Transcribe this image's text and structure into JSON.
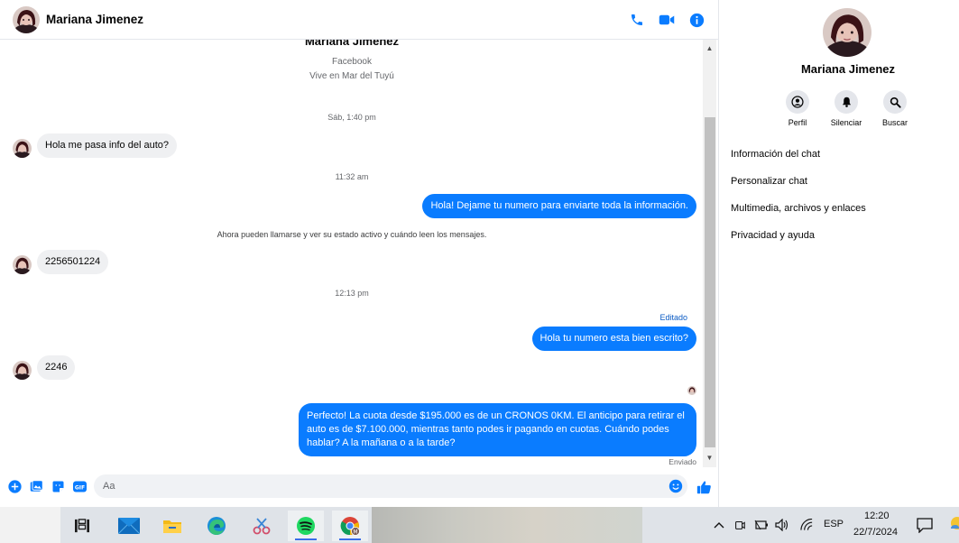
{
  "contact": {
    "name": "Mariana Jimenez"
  },
  "intro": {
    "name": "Mariana Jimenez",
    "platform": "Facebook",
    "location": "Vive en Mar del Tuyú"
  },
  "messages": [
    {
      "type": "timestamp",
      "text": "Sáb, 1:40 pm"
    },
    {
      "type": "in",
      "text": "Hola me pasa info del auto?"
    },
    {
      "type": "timestamp",
      "text": "11:32 am"
    },
    {
      "type": "out",
      "text": "Hola! Dejame tu numero  para enviarte toda la información."
    },
    {
      "type": "system",
      "text": "Ahora pueden llamarse y ver su estado activo y cuándo leen los mensajes."
    },
    {
      "type": "in",
      "text": "2256501224"
    },
    {
      "type": "timestamp",
      "text": "12:13 pm"
    },
    {
      "type": "label",
      "text": "Editado"
    },
    {
      "type": "out",
      "text": "Hola tu numero esta bien escrito?"
    },
    {
      "type": "in",
      "text": "2246"
    },
    {
      "type": "out",
      "text": "Perfecto! La cuota desde $195.000 es de un CRONOS 0KM. El anticipo para retirar el auto es de $7.100.000, mientras tanto podes ir pagando en cuotas. Cuándo podes hablar? A la mañana o a la tarde?"
    },
    {
      "type": "status",
      "text": "Enviado"
    }
  ],
  "composer": {
    "placeholder": "Aa"
  },
  "sidebar": {
    "name": "Mariana Jimenez",
    "actions": [
      {
        "label": "Perfil",
        "icon": "profile-icon"
      },
      {
        "label": "Silenciar",
        "icon": "bell-icon"
      },
      {
        "label": "Buscar",
        "icon": "search-icon"
      }
    ],
    "sections": [
      {
        "label": "Información del chat"
      },
      {
        "label": "Personalizar chat"
      },
      {
        "label": "Multimedia, archivos y enlaces"
      },
      {
        "label": "Privacidad y ayuda"
      }
    ]
  },
  "taskbar": {
    "apps": [
      "task-view",
      "mail",
      "file-explorer",
      "edge",
      "snipping-tool",
      "spotify",
      "chrome"
    ],
    "language": "ESP",
    "time": "12:20",
    "date": "22/7/2024"
  },
  "colors": {
    "accent": "#0a7cff",
    "incoming_bubble": "#eff0f2",
    "icon_blue": "#0a7cff"
  }
}
